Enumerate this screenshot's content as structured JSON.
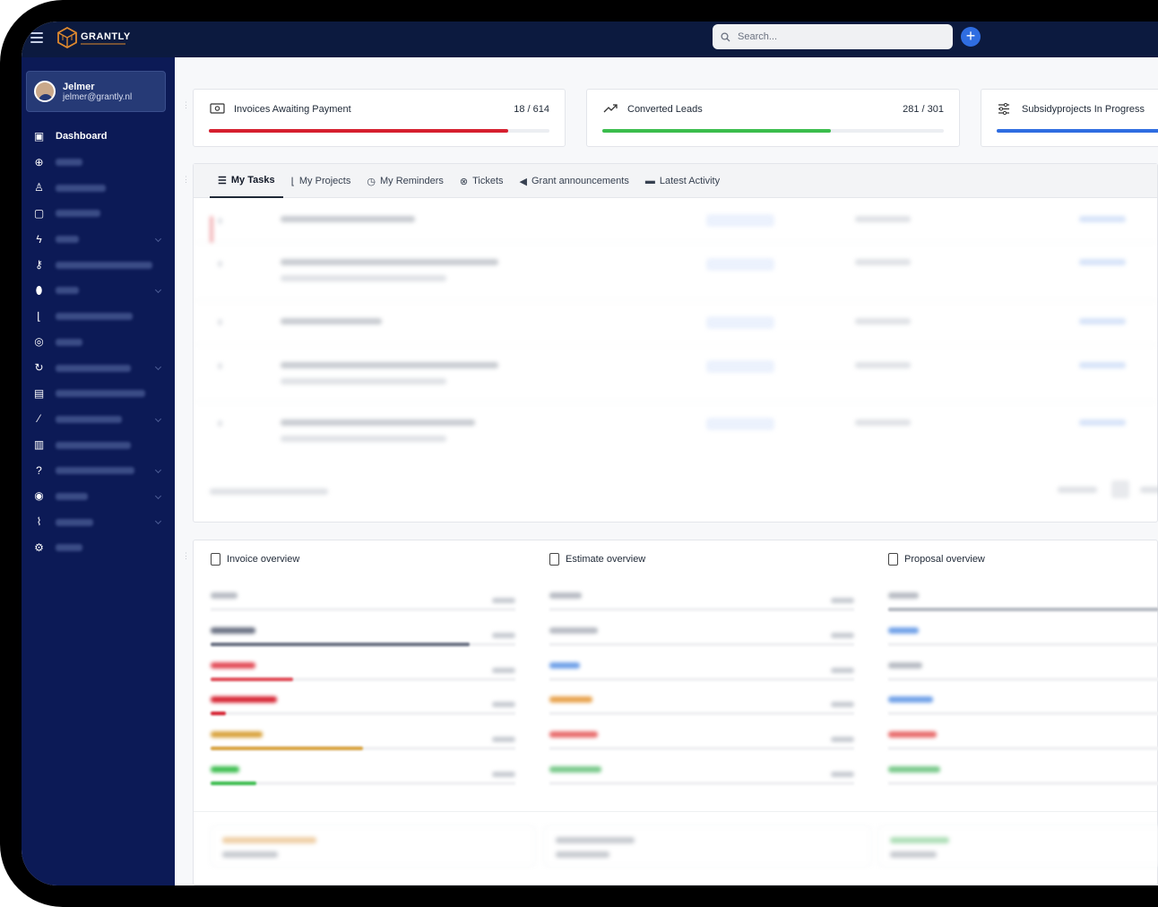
{
  "topbar": {
    "brand": "GRANTLY",
    "search_placeholder": "Search..."
  },
  "user": {
    "name": "Jelmer",
    "email": "jelmer@grantly.nl"
  },
  "sidebar": {
    "items": [
      {
        "label": "Dashboard",
        "icon": "dashboard-icon",
        "readable": true
      },
      {
        "label": "",
        "icon": "crosshair-icon",
        "readable": false
      },
      {
        "label": "",
        "icon": "user-icon",
        "readable": false
      },
      {
        "label": "",
        "icon": "note-icon",
        "readable": false
      },
      {
        "label": "",
        "icon": "bolt-icon",
        "readable": false
      },
      {
        "label": "",
        "icon": "key-icon",
        "readable": false
      },
      {
        "label": "",
        "icon": "tag-icon",
        "readable": false
      },
      {
        "label": "",
        "icon": "chart-bar-icon",
        "readable": false
      },
      {
        "label": "",
        "icon": "check-circle-icon",
        "readable": false
      },
      {
        "label": "",
        "icon": "refresh-icon",
        "readable": false
      },
      {
        "label": "",
        "icon": "file-icon",
        "readable": false
      },
      {
        "label": "",
        "icon": "magic-wand-icon",
        "readable": false
      },
      {
        "label": "",
        "icon": "document-icon",
        "readable": false
      },
      {
        "label": "",
        "icon": "help-icon",
        "readable": false
      },
      {
        "label": "",
        "icon": "record-icon",
        "readable": false
      },
      {
        "label": "",
        "icon": "line-chart-icon",
        "readable": false
      },
      {
        "label": "",
        "icon": "gear-icon",
        "readable": false
      }
    ]
  },
  "stats": [
    {
      "label": "Invoices Awaiting Payment",
      "count": "18 / 614",
      "color": "#d6202f",
      "progress": 0.88
    },
    {
      "label": "Converted Leads",
      "count": "281 / 301",
      "color": "#3bbd4d",
      "progress": 0.67
    },
    {
      "label": "Subsidyprojects In Progress",
      "count": "",
      "color": "#2f6de1",
      "progress": 1.0
    }
  ],
  "tabs": [
    {
      "label": "My Tasks",
      "icon": "tasks-icon",
      "active": true
    },
    {
      "label": "My Projects",
      "icon": "projects-chart-icon",
      "active": false
    },
    {
      "label": "My Reminders",
      "icon": "clock-icon",
      "active": false
    },
    {
      "label": "Tickets",
      "icon": "lifebuoy-icon",
      "active": false
    },
    {
      "label": "Grant announcements",
      "icon": "megaphone-icon",
      "active": false
    },
    {
      "label": "Latest Activity",
      "icon": "calendar-icon",
      "active": false
    }
  ],
  "overviews": [
    {
      "title": "Invoice overview",
      "colors": [
        "#b8bcc4",
        "#6a7183",
        "#e24a55",
        "#d6202f",
        "#d9a23c",
        "#3bbd4d"
      ],
      "fills": [
        0,
        0.85,
        0.27,
        0.05,
        0.5,
        0.15
      ]
    },
    {
      "title": "Estimate overview",
      "colors": [
        "#b8bcc4",
        "#b8bcc4",
        "#6fa0e8",
        "#e8a24c",
        "#e86b6b",
        "#79c98a"
      ],
      "fills": [
        0,
        0,
        0,
        0,
        0,
        0
      ]
    },
    {
      "title": "Proposal overview",
      "colors": [
        "#b8bcc4",
        "#6fa0e8",
        "#b8bcc4",
        "#6fa0e8",
        "#e86b6b",
        "#79c98a"
      ],
      "fills": [
        1.0,
        0,
        0,
        0,
        0,
        0
      ]
    }
  ],
  "colors": {
    "topbar": "#0c1a3f",
    "sidebar": "#0c1a56",
    "accent": "#2f6de1",
    "brand_orange": "#e08a2e"
  }
}
